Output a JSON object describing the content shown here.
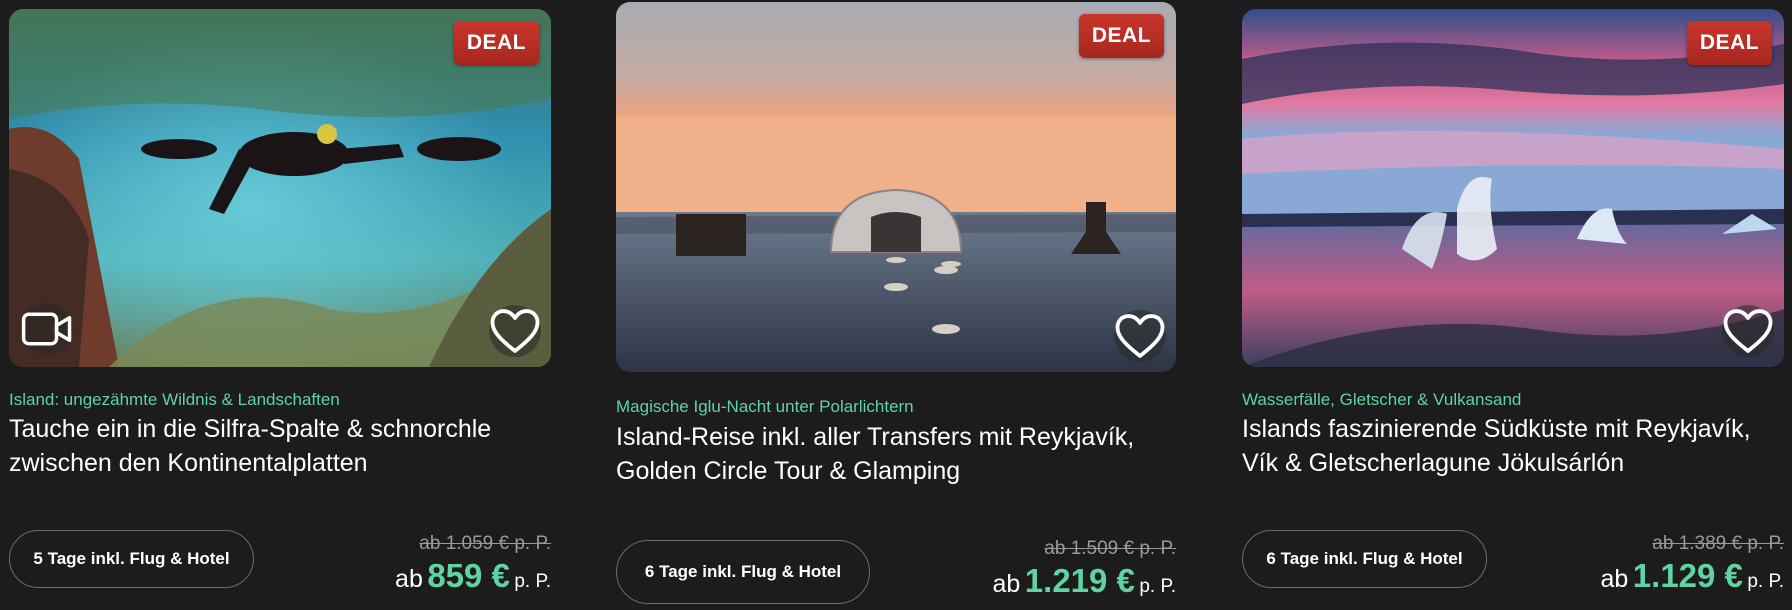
{
  "cards": [
    {
      "deal_label": "DEAL",
      "subtitle": "Island: ungezähmte Wildnis & Landschaften",
      "title": "Tauche ein in die Silfra-Spalte & schnorchle zwischen den Kontinentalplatten",
      "duration": "5 Tage inkl. Flug & Hotel",
      "old_price": "ab 1.059 € p. P.",
      "price_prefix": "ab",
      "price": "859 €",
      "price_suffix": "p. P.",
      "has_video": true
    },
    {
      "deal_label": "DEAL",
      "subtitle": "Magische Iglu-Nacht unter Polarlichtern",
      "title": "Island-Reise inkl. aller Transfers mit Reykjavík, Golden Circle Tour & Glamping",
      "duration": "6 Tage inkl. Flug & Hotel",
      "old_price": "ab 1.509 € p. P.",
      "price_prefix": "ab",
      "price": "1.219 €",
      "price_suffix": "p. P.",
      "has_video": false
    },
    {
      "deal_label": "DEAL",
      "subtitle": "Wasserfälle, Gletscher & Vulkansand",
      "title": "Islands faszinierende Südküste mit Reykjavík, Vík & Gletscherlagune Jökulsárlón",
      "duration": "6 Tage inkl. Flug & Hotel",
      "old_price": "ab 1.389 € p. P.",
      "price_prefix": "ab",
      "price": "1.129 €",
      "price_suffix": "p. P.",
      "has_video": false
    }
  ],
  "colors": {
    "accent": "#5fd3a4",
    "deal_red": "#c8372d",
    "background": "#1c1c1c"
  },
  "icons": {
    "favorite": "heart-icon",
    "video": "video-camera-icon"
  }
}
